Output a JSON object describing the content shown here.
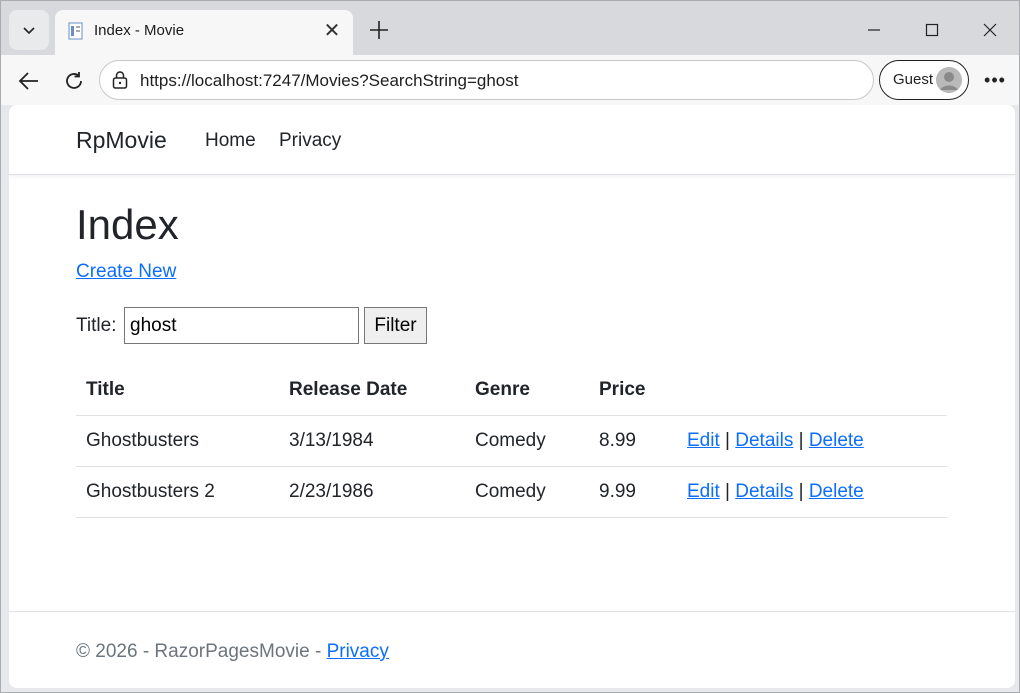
{
  "browser": {
    "tab_title": "Index - Movie",
    "url": "https://localhost:7247/Movies?SearchString=ghost",
    "profile_label": "Guest"
  },
  "site": {
    "brand": "RpMovie",
    "nav": [
      "Home",
      "Privacy"
    ]
  },
  "page": {
    "title": "Index",
    "create_link": "Create New",
    "filter": {
      "label": "Title:",
      "value": "ghost",
      "button": "Filter"
    },
    "table": {
      "headers": [
        "Title",
        "Release Date",
        "Genre",
        "Price"
      ],
      "rows": [
        {
          "title": "Ghostbusters",
          "release_date": "3/13/1984",
          "genre": "Comedy",
          "price": "8.99"
        },
        {
          "title": "Ghostbusters 2",
          "release_date": "2/23/1986",
          "genre": "Comedy",
          "price": "9.99"
        }
      ],
      "actions": {
        "edit": "Edit",
        "details": "Details",
        "delete": "Delete",
        "separator": "|"
      }
    }
  },
  "footer": {
    "text": "© 2026 - RazorPagesMovie - ",
    "privacy": "Privacy"
  },
  "colors": {
    "link": "#0d6efd",
    "text": "#212529",
    "muted": "#6c757d"
  }
}
